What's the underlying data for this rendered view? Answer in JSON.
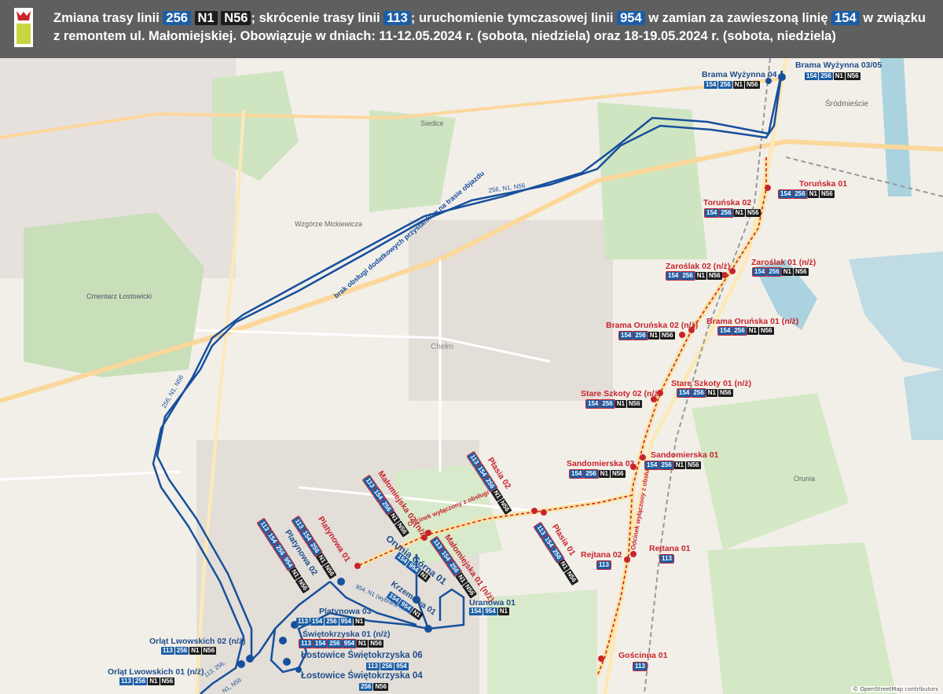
{
  "header": {
    "title_parts": [
      {
        "t": "Zmiana trasy linii ",
        "k": "text"
      },
      {
        "t": "256",
        "k": "blue"
      },
      {
        "t": " ",
        "k": "text"
      },
      {
        "t": "N1",
        "k": "black"
      },
      {
        "t": " ",
        "k": "text"
      },
      {
        "t": "N56",
        "k": "black"
      },
      {
        "t": "; skrócenie trasy linii ",
        "k": "text"
      },
      {
        "t": "113",
        "k": "blue"
      },
      {
        "t": "; uruchomienie tymczasowej linii ",
        "k": "text"
      },
      {
        "t": "954",
        "k": "blue"
      },
      {
        "t": " w zamian za zawieszoną linię ",
        "k": "text"
      },
      {
        "t": "154",
        "k": "blue"
      },
      {
        "t": " w związku z remontem ul. Małomiejskiej. Obowiązuje w dniach: 11-12.05.2024 r. (sobota, niedziela) oraz 18-19.05.2024 r. (sobota, niedziela)",
        "k": "text"
      }
    ]
  },
  "colors": {
    "route": "#17509c",
    "closed": "#c8242b",
    "park": "#cfe5c2",
    "water": "#aad3df",
    "road": "#fbd79a",
    "bg": "#f2efe9"
  },
  "route_labels": {
    "r1": "256, N1, N56",
    "r2": "256, N1, N56",
    "r3": "brak obsługi dodatkowych przystanków na trasie objazdu",
    "r4": "954, N1 (wybrane kursy)",
    "r5": "113, 256,",
    "r6": "N1, N56",
    "closed1": "Odcinek wyłączony z obsługi",
    "closed2": "Odcinek wyłączony z obsługi"
  },
  "stops_blue": [
    {
      "id": "brama-wyzynna-03-05",
      "name": "Brama Wyżynna 03/05",
      "lines": [
        "154",
        "256",
        "N1",
        "N56"
      ]
    },
    {
      "id": "brama-wyzynna-04",
      "name": "Brama Wyżynna 04",
      "lines": [
        "154",
        "256",
        "N1",
        "N56"
      ]
    },
    {
      "id": "orunia-gorna-01",
      "name": "Orunia Górna 01",
      "lines": [
        "154",
        "954",
        "N1"
      ]
    },
    {
      "id": "krzemowa-01",
      "name": "Krzemowa 01",
      "lines": [
        "154",
        "954",
        "N1"
      ]
    },
    {
      "id": "uranowa-01",
      "name": "Uranowa 01",
      "lines": [
        "154",
        "954",
        "N1"
      ]
    },
    {
      "id": "platynowa-03",
      "name": "Platynowa 03",
      "lines": [
        "113",
        "154",
        "256",
        "954",
        "N1"
      ]
    },
    {
      "id": "swietokrzyska-01",
      "name": "Świętokrzyska 01 (n/ż)",
      "lines": [
        "113",
        "154",
        "256",
        "954",
        "N1",
        "N56"
      ]
    },
    {
      "id": "lostowice-06",
      "name": "Łostowice Świętokrzyska 06",
      "lines": [
        "113",
        "256",
        "954"
      ]
    },
    {
      "id": "lostowice-04",
      "name": "Łostowice Świętokrzyska 04",
      "lines": [
        "256",
        "N56"
      ]
    },
    {
      "id": "orlat-02",
      "name": "Orląt Lwowskich 02 (n/ż)",
      "lines": [
        "113",
        "256",
        "N1",
        "N56"
      ]
    },
    {
      "id": "orlat-01",
      "name": "Orląt Lwowskich 01 (n/ż)",
      "lines": [
        "113",
        "256",
        "N1",
        "N56"
      ]
    },
    {
      "id": "platynowa-02",
      "name": "Platynowa 02",
      "lines": [
        "113",
        "154",
        "256",
        "954",
        "N1",
        "N56"
      ]
    }
  ],
  "stops_red": [
    {
      "id": "torunska-01",
      "name": "Toruńska 01",
      "lines": [
        "154",
        "256",
        "N1",
        "N56"
      ]
    },
    {
      "id": "torunska-02",
      "name": "Toruńska 02",
      "lines": [
        "154",
        "256",
        "N1",
        "N56"
      ]
    },
    {
      "id": "zaroslak-02",
      "name": "Zaroślak 02 (n/ż)",
      "lines": [
        "154",
        "256",
        "N1",
        "N56"
      ]
    },
    {
      "id": "zaroslak-01",
      "name": "Zaroślak 01 (n/ż)",
      "lines": [
        "154",
        "256",
        "N1",
        "N56"
      ]
    },
    {
      "id": "brama-orunska-02",
      "name": "Brama Oruńska 02 (n/ż)",
      "lines": [
        "154",
        "256",
        "N1",
        "N56"
      ]
    },
    {
      "id": "brama-orunska-01",
      "name": "Brama Oruńska 01 (n/ż)",
      "lines": [
        "154",
        "256",
        "N1",
        "N56"
      ]
    },
    {
      "id": "stare-szkoty-02",
      "name": "Stare Szkoty 02 (n/ż)",
      "lines": [
        "154",
        "256",
        "N1",
        "N56"
      ]
    },
    {
      "id": "stare-szkoty-01",
      "name": "Stare Szkoty 01 (n/ż)",
      "lines": [
        "154",
        "256",
        "N1",
        "N56"
      ]
    },
    {
      "id": "sandomierska-02",
      "name": "Sandomierska 02",
      "lines": [
        "154",
        "256",
        "N1",
        "N56"
      ]
    },
    {
      "id": "sandomierska-01",
      "name": "Sandomierska 01",
      "lines": [
        "154",
        "256",
        "N1",
        "N56"
      ]
    },
    {
      "id": "rejtana-02",
      "name": "Rejtana 02",
      "lines": [
        "113"
      ]
    },
    {
      "id": "rejtana-01",
      "name": "Rejtana 01",
      "lines": [
        "113"
      ]
    },
    {
      "id": "goscinna-01",
      "name": "Gościnna 01",
      "lines": [
        "113"
      ]
    },
    {
      "id": "plasia-02",
      "name": "Płasia 02",
      "lines": [
        "113",
        "154",
        "256",
        "N1",
        "N56"
      ]
    },
    {
      "id": "plasia-01",
      "name": "Płasia 01",
      "lines": [
        "113",
        "154",
        "256",
        "N1",
        "N56"
      ]
    },
    {
      "id": "malomiejska-02",
      "name": "Małomiejska 02 (n/ż)",
      "lines": [
        "113",
        "154",
        "256",
        "N1",
        "N56"
      ]
    },
    {
      "id": "malomiejska-01",
      "name": "Małomiejska 01 (n/ż)",
      "lines": [
        "113",
        "154",
        "256",
        "N1",
        "N56"
      ]
    },
    {
      "id": "platynowa-01",
      "name": "Platynowa 01",
      "lines": [
        "113",
        "154",
        "256",
        "N1",
        "N56"
      ]
    }
  ],
  "place_names": {
    "srodmiescie": "Śródmieście",
    "cmentarz": "Cmentarz Łostowicki",
    "wzgorze": "Wzgórze Mickiewicza",
    "siedlce": "Siedlce",
    "chelm": "Chełm",
    "orunia": "Orunia"
  },
  "attribution": "© OpenStreetMap contributors"
}
